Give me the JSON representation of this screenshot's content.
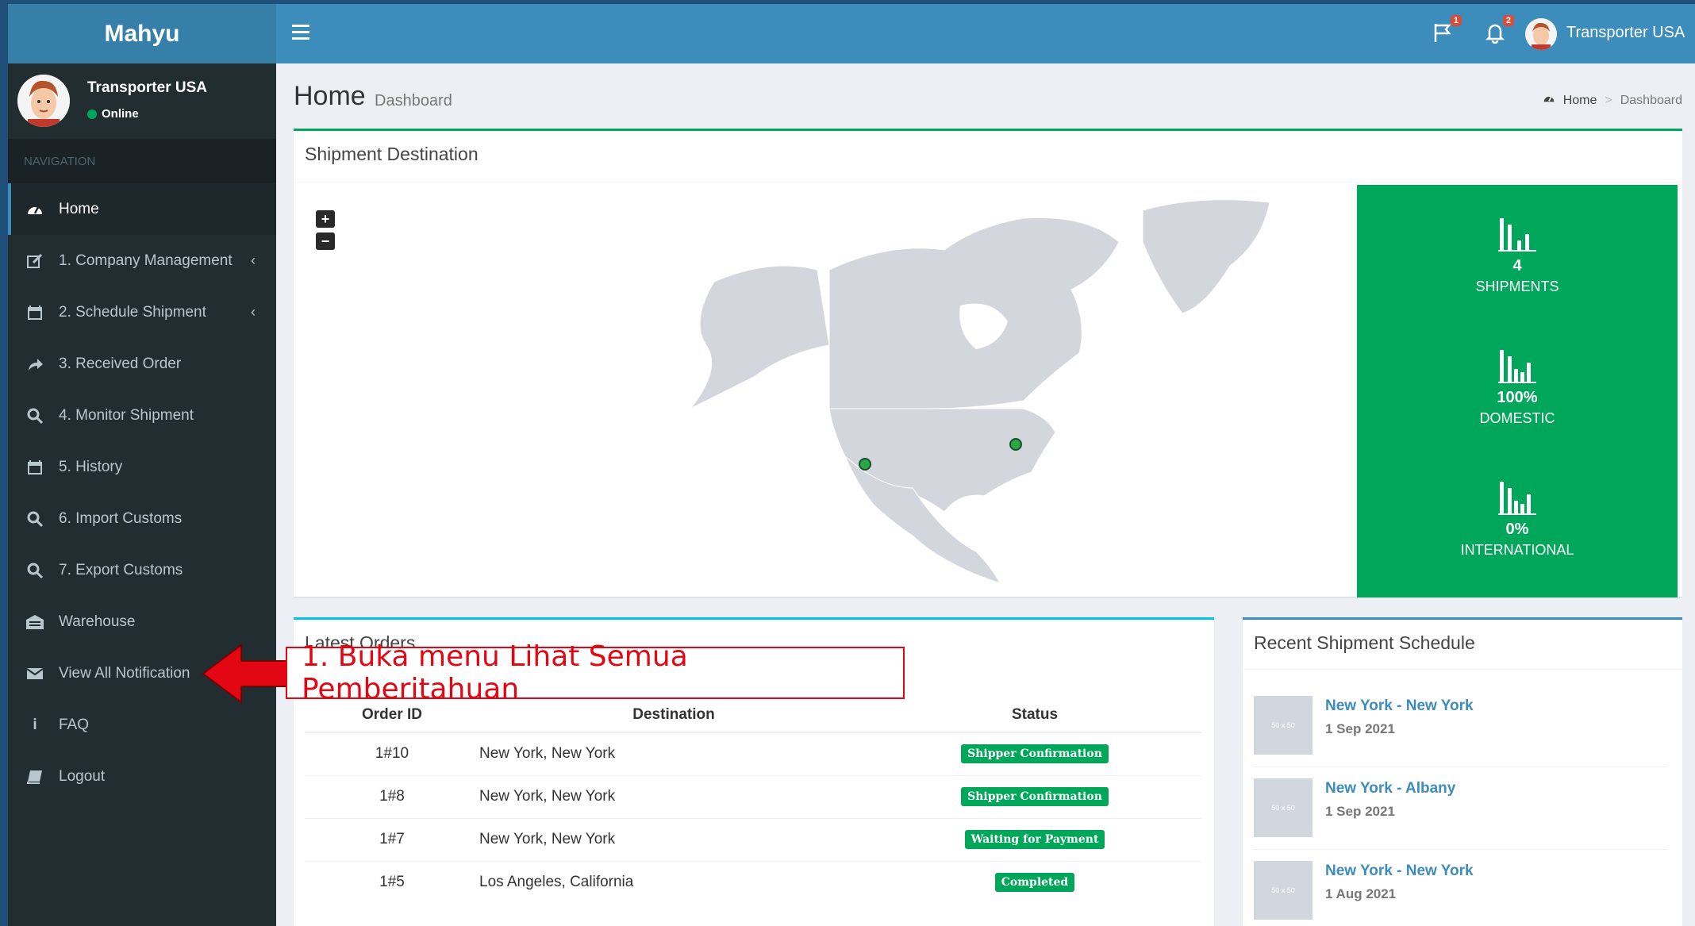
{
  "app": {
    "brand": "Mahyu"
  },
  "user": {
    "name": "Transporter USA",
    "status": "Online"
  },
  "sidebar": {
    "header": "NAVIGATION",
    "items": [
      {
        "label": "Home",
        "icon": "dashboard-icon",
        "active": true
      },
      {
        "label": "1. Company Management",
        "icon": "edit-icon",
        "submenu": true
      },
      {
        "label": "2. Schedule Shipment",
        "icon": "calendar-icon",
        "submenu": true
      },
      {
        "label": "3. Received Order",
        "icon": "share-icon"
      },
      {
        "label": "4. Monitor Shipment",
        "icon": "search-icon"
      },
      {
        "label": "5. History",
        "icon": "calendar-icon"
      },
      {
        "label": "6. Import Customs",
        "icon": "search-icon"
      },
      {
        "label": "7. Export Customs",
        "icon": "search-icon"
      },
      {
        "label": "Warehouse",
        "icon": "warehouse-icon"
      },
      {
        "label": "View All Notification",
        "icon": "envelope-icon"
      },
      {
        "label": "FAQ",
        "icon": "info-icon"
      },
      {
        "label": "Logout",
        "icon": "book-icon"
      }
    ]
  },
  "header": {
    "flag_badge": "1",
    "bell_badge": "2",
    "user_name": "Transporter USA"
  },
  "page": {
    "title": "Home",
    "subtitle": "Dashboard",
    "breadcrumb": {
      "home": "Home",
      "sep": ">",
      "current": "Dashboard"
    }
  },
  "map_box": {
    "title": "Shipment Destination",
    "zoom_in": "+",
    "zoom_out": "−",
    "stats": [
      {
        "value": "4",
        "label": "SHIPMENTS"
      },
      {
        "value": "100%",
        "label": "DOMESTIC"
      },
      {
        "value": "0%",
        "label": "INTERNATIONAL"
      }
    ]
  },
  "orders": {
    "title": "Latest Orders",
    "columns": [
      "Order ID",
      "Destination",
      "Status"
    ],
    "rows": [
      {
        "id": "1#10",
        "destination": "New York, New York",
        "status": "Shipper Confirmation"
      },
      {
        "id": "1#8",
        "destination": "New York, New York",
        "status": "Shipper Confirmation"
      },
      {
        "id": "1#7",
        "destination": "New York, New York",
        "status": "Waiting for Payment"
      },
      {
        "id": "1#5",
        "destination": "Los Angeles, California",
        "status": "Completed"
      }
    ]
  },
  "schedule": {
    "title": "Recent Shipment Schedule",
    "thumb_text": "50 x 50",
    "items": [
      {
        "route": "New York - New York",
        "date": "1 Sep 2021"
      },
      {
        "route": "New York - Albany",
        "date": "1 Sep 2021"
      },
      {
        "route": "New York - New York",
        "date": "1 Aug 2021"
      }
    ]
  },
  "annotation": {
    "text": "1. Buka menu Lihat Semua Pemberitahuan",
    "color": "#e30613"
  },
  "colors": {
    "primary": "#3c8dbc",
    "success": "#00a65a",
    "sidebar": "#222d32"
  }
}
